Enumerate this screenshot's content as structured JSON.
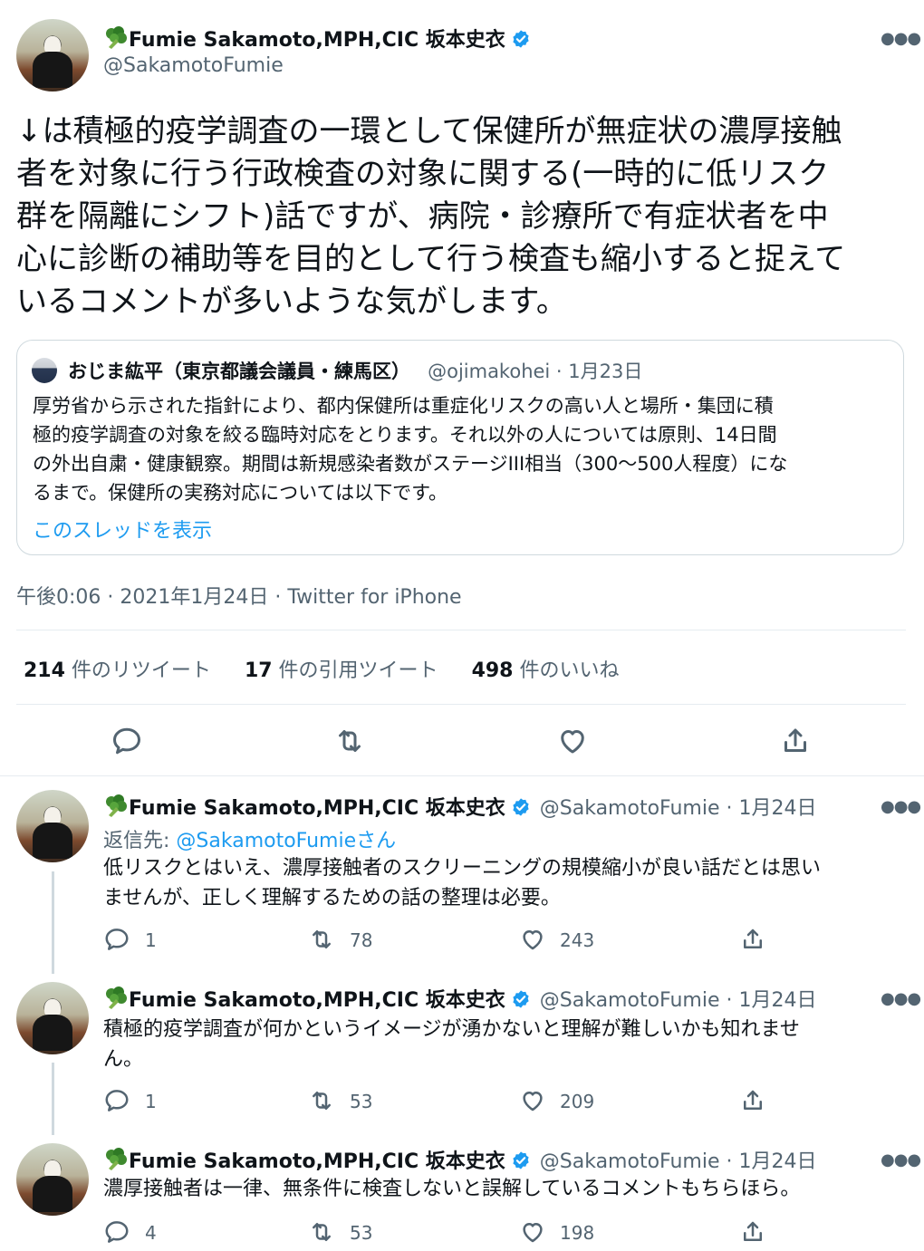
{
  "main_tweet": {
    "author_name": "Fumie Sakamoto,MPH,CIC 坂本史衣",
    "handle": "@SakamotoFumie",
    "text_lines": [
      "↓は積極的疫学調査の一環として保健所が無症状の濃厚接触",
      "者を対象に行う行政検査の対象に関する(一時的に低リスク",
      "群を隔離にシフト)話ですが、病院・診療所で有症状者を中",
      "心に診断の補助等を目的として行う検査も縮小すると捉えて",
      "いるコメントが多いような気がします。"
    ],
    "quoted": {
      "author_name": "おじま紘平（東京都議会議員・練馬区）",
      "handle_date": "@ojimakohei · 1月23日",
      "text_lines": [
        "厚労省から示された指針により、都内保健所は重症化リスクの高い人と場所・集団に積",
        "極的疫学調査の対象を絞る臨時対応をとります。それ以外の人については原則、14日間",
        "の外出自粛・健康観察。期間は新規感染者数がステージIII相当（300〜500人程度）にな",
        "るまで。保健所の実務対応については以下です。"
      ],
      "show_thread": "このスレッドを表示"
    },
    "timestamp": "午後0:06 · 2021年1月24日 · Twitter for iPhone",
    "stats": {
      "retweets_count": "214",
      "retweets_label": " 件のリツイート",
      "quotes_count": "17",
      "quotes_label": " 件の引用ツイート",
      "likes_count": "498",
      "likes_label": " 件のいいね"
    }
  },
  "replies": [
    {
      "author_name": "Fumie Sakamoto,MPH,CIC 坂本史衣",
      "handle_date": "@SakamotoFumie · 1月24日",
      "reply_to_prefix": "返信先: ",
      "reply_to_handle": "@SakamotoFumie",
      "reply_to_suffix": "さん",
      "text_lines": [
        "低リスクとはいえ、濃厚接触者のスクリーニングの規模縮小が良い話だとは思い",
        "ませんが、正しく理解するための話の整理は必要。"
      ],
      "replies": "1",
      "retweets": "78",
      "likes": "243"
    },
    {
      "author_name": "Fumie Sakamoto,MPH,CIC 坂本史衣",
      "handle_date": "@SakamotoFumie · 1月24日",
      "text_lines": [
        "積極的疫学調査が何かというイメージが湧かないと理解が難しいかも知れませ",
        "ん。"
      ],
      "replies": "1",
      "retweets": "53",
      "likes": "209"
    },
    {
      "author_name": "Fumie Sakamoto,MPH,CIC 坂本史衣",
      "handle_date": "@SakamotoFumie · 1月24日",
      "text_lines": [
        "濃厚接触者は一律、無条件に検査しないと誤解しているコメントもちらほら。"
      ],
      "replies": "4",
      "retweets": "53",
      "likes": "198"
    }
  ],
  "icons": {
    "name_emoji": "broccoli-icon",
    "verified": "verified-badge-icon",
    "more": "more-options-icon",
    "reply": "reply-icon",
    "retweet": "retweet-icon",
    "like": "heart-icon",
    "share": "share-icon"
  },
  "colors": {
    "accent": "#1d9bf0",
    "secondary_text": "#536471",
    "divider": "#e6ecf0"
  }
}
